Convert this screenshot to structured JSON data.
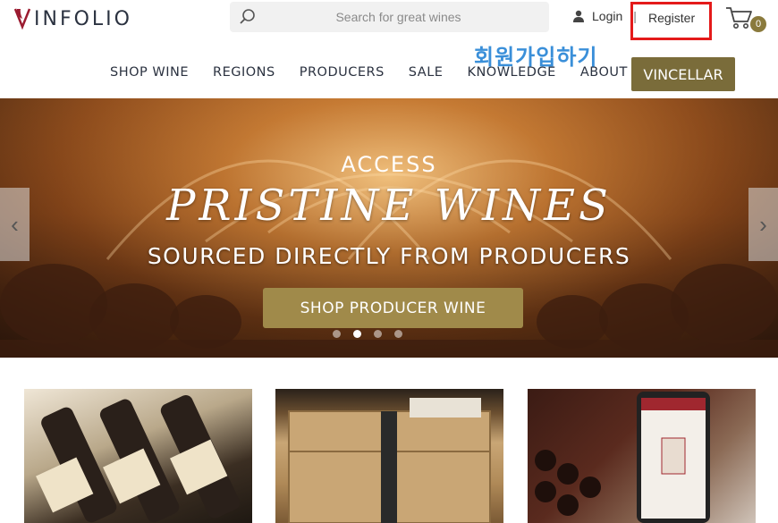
{
  "header": {
    "logo_text": "INFOLIO",
    "search_placeholder": "Search for great wines",
    "login_label": "Login",
    "separator": "|",
    "register_label": "Register",
    "cart_count": "0",
    "annotation_text": "회원가입하기",
    "annotation_color": "#3a8fd9",
    "highlight_color": "#e41a1a"
  },
  "nav": {
    "items": [
      "SHOP WINE",
      "REGIONS",
      "PRODUCERS",
      "SALE",
      "KNOWLEDGE",
      "ABOUT"
    ],
    "vincellar_label": "VINCELLAR"
  },
  "hero": {
    "line1": "ACCESS",
    "title": "PRISTINE WINES",
    "subtitle": "SOURCED DIRECTLY FROM PRODUCERS",
    "cta_label": "SHOP PRODUCER WINE",
    "prev_icon": "chevron-left-icon",
    "next_icon": "chevron-right-icon",
    "slide_count": 4,
    "active_slide": 2
  },
  "theme": {
    "accent": "#a08a4a",
    "vincellar_bg": "#7a6c3a",
    "logo_red": "#9b1b30"
  }
}
